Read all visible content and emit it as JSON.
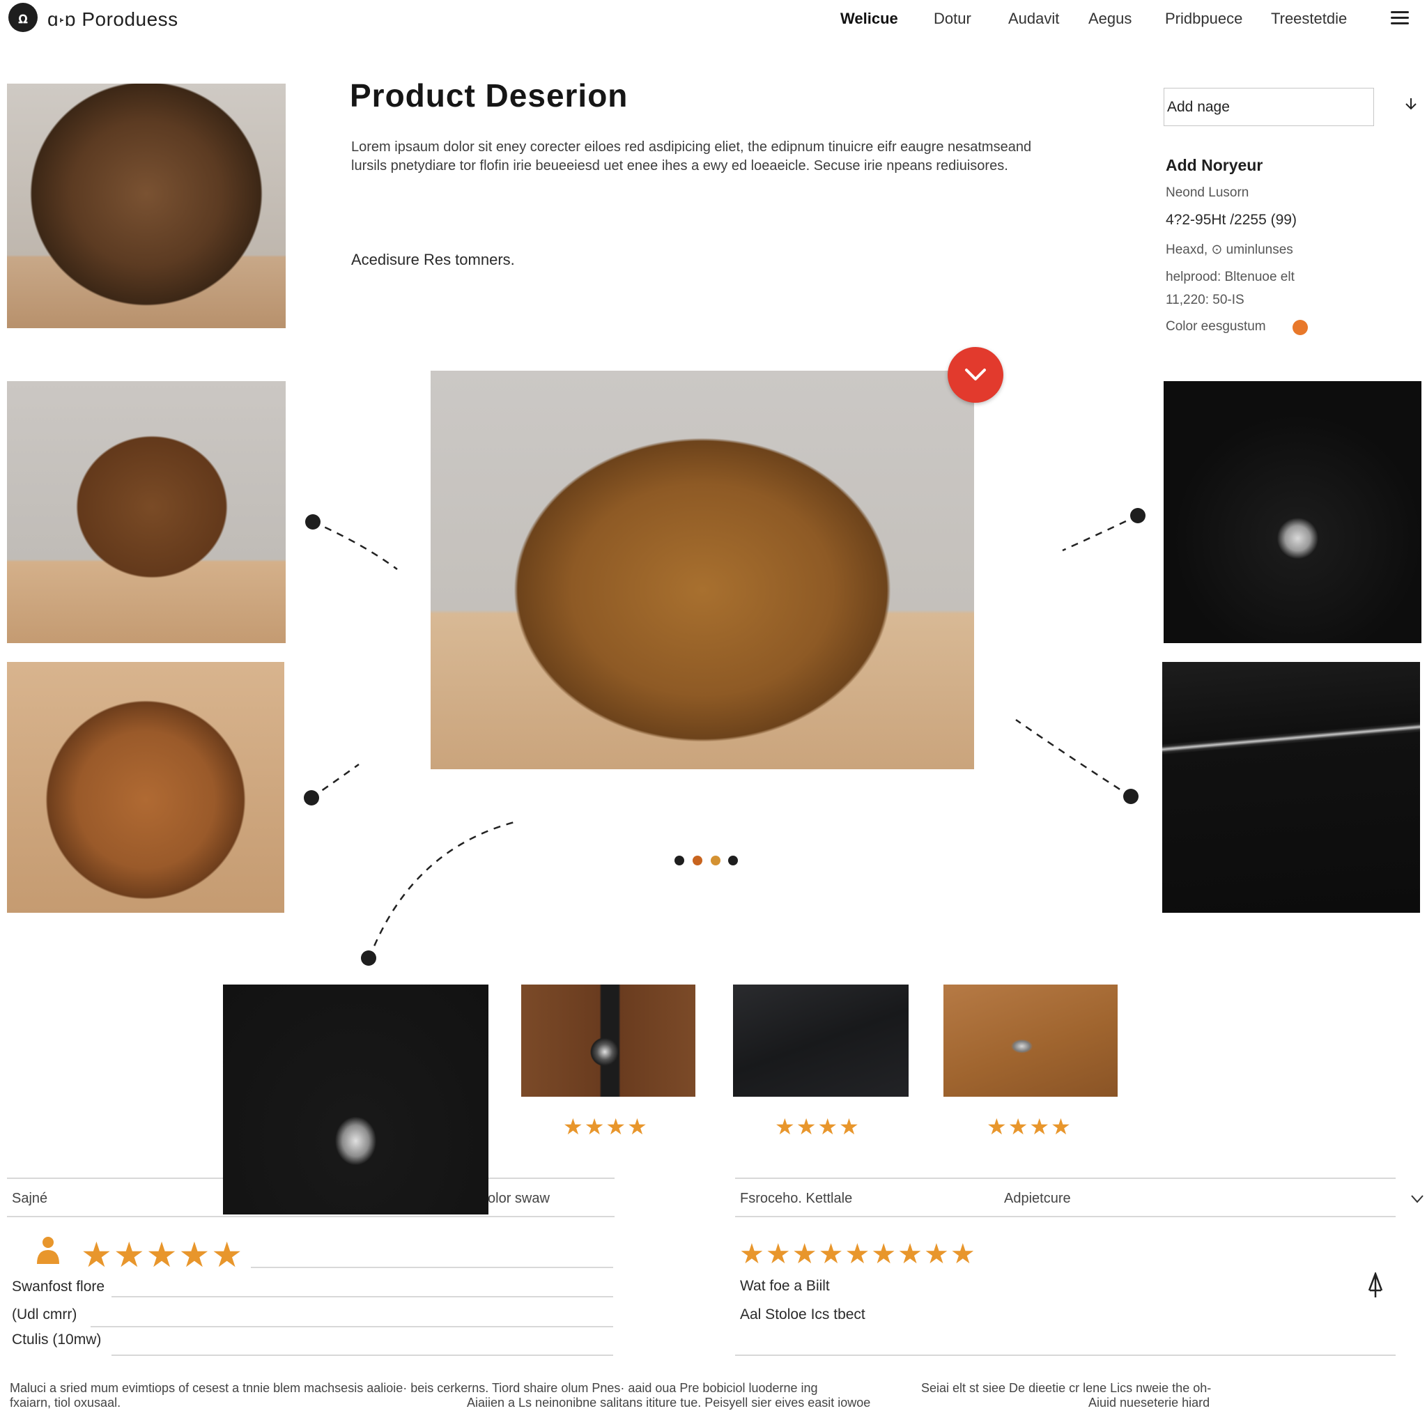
{
  "header": {
    "logo_glyph": "ꭥ",
    "brand": "ɑ꭫ɒ Poroduess",
    "nav": [
      "Welicue",
      "Dotur",
      "Audavit",
      "Aegus",
      "Pridbpuece",
      "Treestetdie"
    ]
  },
  "product": {
    "title": "Product Deserion",
    "description": "Lorem ipsaum dolor sit eney corecter eiloes red asdipicing eliet, the edipnum tinuicre eifr eaugre nesatmseand lursils pnetydiare tor flofin irie beueeiesd uet enee ihes a ewy ed loeaeicle. Secuse irie npeans rediuisores.",
    "subline": "Acedisure Res tomners."
  },
  "options": {
    "select_value": "Add nage",
    "heading": "Add Noryeur",
    "lines": [
      "Neond Lusorn",
      "4?2-95Ht /2255 (99)",
      "Heaxd, ⊙ uminlunses",
      "helprood: Bltenuoe elt",
      "11,220: 50-IS",
      "Color eesgustum"
    ],
    "swatch_color": "#e8782a"
  },
  "gallery": {
    "favorite_color": "#e23a2d",
    "pager_colors": [
      "#1e1e1e",
      "#c8641e",
      "#d49232",
      "#1e1e1e"
    ]
  },
  "thumb_ratings": [
    "★★★★",
    "★★★★",
    "★★★★"
  ],
  "reviews_left": {
    "col1": "Sajné",
    "col2": "olor swaw",
    "stars": "★★★★★",
    "rows": [
      "Swanfost flore",
      "(Udl cmrr)",
      "Ctulis (10mw)"
    ]
  },
  "reviews_right": {
    "col1": "Fsroceho. Kettlale",
    "col2": "Adpietcure",
    "stars": "★★★★★★★★★",
    "rows": [
      "Wat foe a Biilt",
      "Aal Stoloe Ics tbect"
    ]
  },
  "footer": {
    "left": "Maluci a sried mum evimtiops of cesest a tnnie blem machsesis aalioie· beis cerkerns. Tiord shaire olum Pnes· aaid oua Pre bobiciol luoderne ing",
    "left2": "fxaiarn, tiol oxusaal.",
    "middle": "Aiaiien a Ls neinonibne salitans ititure tue. Peisyell sier eives easit iowoe",
    "right": "Seiai elt st siee De dieetie cr lene Lics nweie the oh-",
    "right2": "Aiuid nueseterie hiard"
  }
}
